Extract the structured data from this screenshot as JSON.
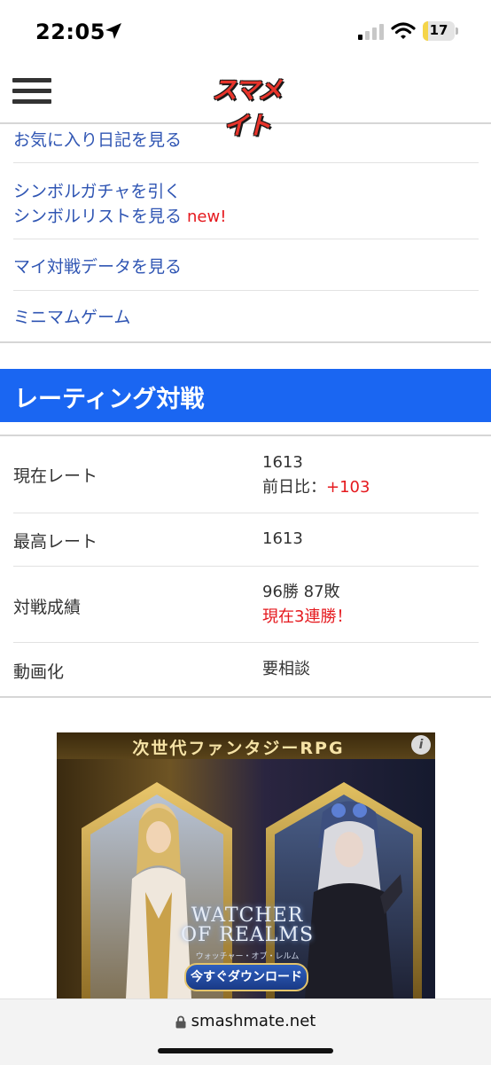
{
  "status_bar": {
    "time": "22:05",
    "battery_level": "17",
    "icons": [
      "location-arrow-icon",
      "cellular-signal-icon",
      "wifi-icon",
      "battery-icon"
    ]
  },
  "header": {
    "logo_text": "スマメイト",
    "menu_icon": "hamburger-menu-icon"
  },
  "menu": {
    "items": [
      {
        "label": "お気に入り日記を見る"
      },
      {
        "label": "シンボルガチャを引く"
      },
      {
        "label": "シンボルリストを見る",
        "badge": "new!"
      },
      {
        "label": "マイ対戦データを見る"
      },
      {
        "label": "ミニマムゲーム"
      }
    ]
  },
  "rating": {
    "section_title": "レーティング対戦",
    "rows": [
      {
        "label": "現在レート",
        "value": "1613",
        "sub_prefix": "前日比：",
        "sub_value": "+103"
      },
      {
        "label": "最高レート",
        "value": "1613"
      },
      {
        "label": "対戦成績",
        "value": "96勝 87敗",
        "sub_value": "現在3連勝！"
      },
      {
        "label": "動画化",
        "value": "要相談"
      }
    ]
  },
  "ad": {
    "headline": "次世代ファンタジーRPG",
    "logo_line1": "WATCHER",
    "logo_line2": "OF REALMS",
    "logo_sub": "ウォッチャー・オブ・レルム",
    "cta": "今すぐダウンロード",
    "info_icon": "info-icon"
  },
  "browser": {
    "url": "smashmate.net"
  },
  "colors": {
    "link": "#2f55b3",
    "accent_blue": "#1a66f2",
    "highlight_red": "#e5191e"
  }
}
